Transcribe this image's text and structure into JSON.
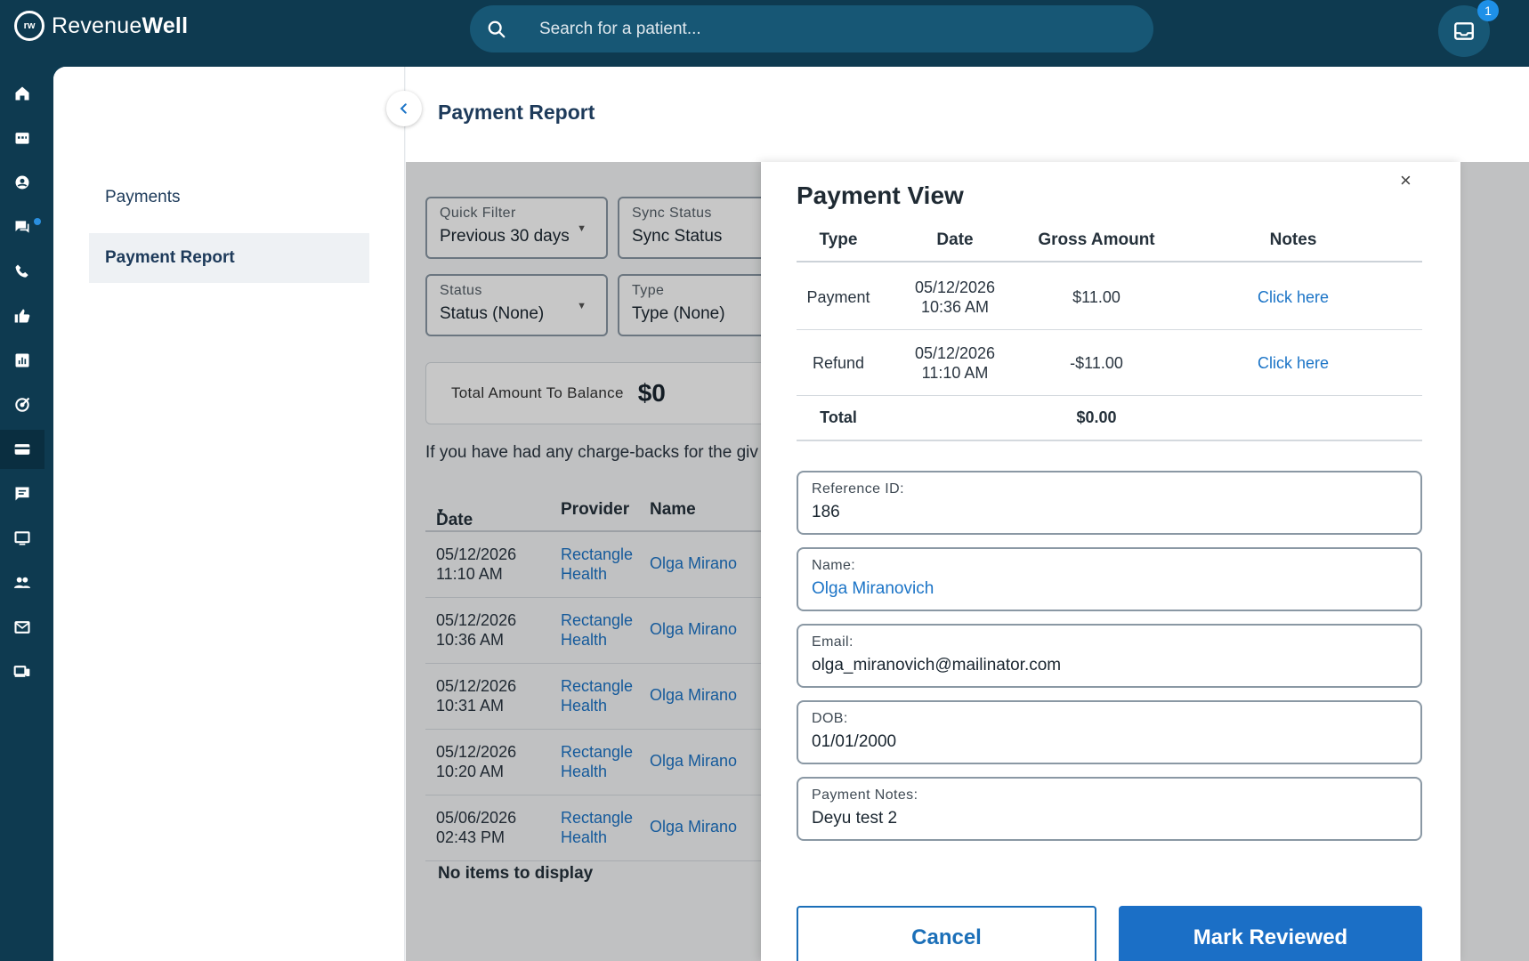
{
  "app": {
    "brand_light": "Revenue",
    "brand_bold": "Well",
    "logo_text": "rw"
  },
  "search": {
    "placeholder": "Search for a patient..."
  },
  "notifications": {
    "count": "1"
  },
  "rail": [
    "home-icon",
    "calendar-icon",
    "user-icon",
    "chat-icon",
    "phone-icon",
    "thumbs-up-icon",
    "report-icon",
    "target-icon",
    "card-icon",
    "message-icon",
    "screen-icon",
    "people-icon",
    "mail-icon",
    "devices-icon"
  ],
  "subnav": {
    "items": [
      {
        "label": "Payments"
      },
      {
        "label": "Payment Report"
      }
    ]
  },
  "page": {
    "title": "Payment Report"
  },
  "filters": {
    "quick_filter": {
      "label": "Quick Filter",
      "value": "Previous 30 days"
    },
    "sync_status": {
      "label": "Sync Status",
      "value": "Sync Status"
    },
    "status": {
      "label": "Status",
      "value": "Status (None)"
    },
    "type": {
      "label": "Type",
      "value": "Type (None)"
    }
  },
  "balance": {
    "label": "Total Amount To Balance",
    "value": "$0"
  },
  "info_text": "If you have had any charge-backs for the giv",
  "table": {
    "headers": {
      "date": "Date",
      "provider": "Provider",
      "name": "Name"
    },
    "rows": [
      {
        "date": "05/12/2026",
        "time": "11:10 AM",
        "provider1": "Rectangle",
        "provider2": "Health",
        "name": "Olga Mirano"
      },
      {
        "date": "05/12/2026",
        "time": "10:36 AM",
        "provider1": "Rectangle",
        "provider2": "Health",
        "name": "Olga Mirano"
      },
      {
        "date": "05/12/2026",
        "time": "10:31 AM",
        "provider1": "Rectangle",
        "provider2": "Health",
        "name": "Olga Mirano"
      },
      {
        "date": "05/12/2026",
        "time": "10:20 AM",
        "provider1": "Rectangle",
        "provider2": "Health",
        "name": "Olga Mirano"
      },
      {
        "date": "05/06/2026",
        "time": "02:43 PM",
        "provider1": "Rectangle",
        "provider2": "Health",
        "name": "Olga Mirano"
      }
    ],
    "empty": "No items to display"
  },
  "modal": {
    "title": "Payment View",
    "close": "×",
    "headers": {
      "type": "Type",
      "date": "Date",
      "gross": "Gross Amount",
      "notes": "Notes"
    },
    "rows": [
      {
        "type": "Payment",
        "date": "05/12/2026",
        "time": "10:36 AM",
        "gross": "$11.00",
        "notes": "Click here"
      },
      {
        "type": "Refund",
        "date": "05/12/2026",
        "time": "11:10 AM",
        "gross": "-$11.00",
        "notes": "Click here"
      }
    ],
    "total": {
      "label": "Total",
      "value": "$0.00"
    },
    "fields": {
      "reference": {
        "label": "Reference ID:",
        "value": "186"
      },
      "name": {
        "label": "Name:",
        "value": "Olga Miranovich"
      },
      "email": {
        "label": "Email:",
        "value": "olga_miranovich@mailinator.com"
      },
      "dob": {
        "label": "DOB:",
        "value": "01/01/2000"
      },
      "notes": {
        "label": "Payment Notes:",
        "value": "Deyu test 2"
      }
    },
    "cancel_label": "Cancel",
    "review_label": "Mark Reviewed"
  }
}
